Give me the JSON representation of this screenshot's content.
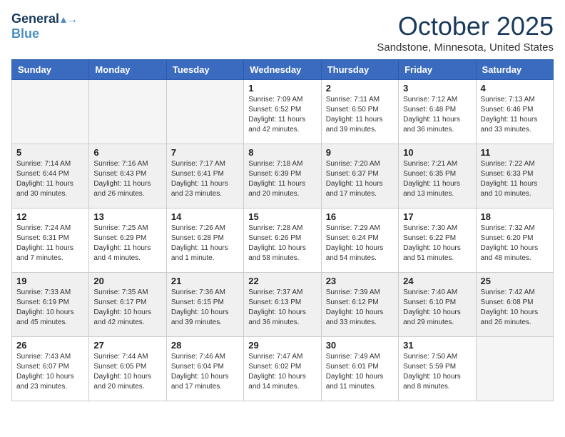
{
  "header": {
    "logo_line1": "General",
    "logo_line2": "Blue",
    "month": "October 2025",
    "location": "Sandstone, Minnesota, United States"
  },
  "days_of_week": [
    "Sunday",
    "Monday",
    "Tuesday",
    "Wednesday",
    "Thursday",
    "Friday",
    "Saturday"
  ],
  "weeks": [
    [
      {
        "day": "",
        "info": ""
      },
      {
        "day": "",
        "info": ""
      },
      {
        "day": "",
        "info": ""
      },
      {
        "day": "1",
        "info": "Sunrise: 7:09 AM\nSunset: 6:52 PM\nDaylight: 11 hours\nand 42 minutes."
      },
      {
        "day": "2",
        "info": "Sunrise: 7:11 AM\nSunset: 6:50 PM\nDaylight: 11 hours\nand 39 minutes."
      },
      {
        "day": "3",
        "info": "Sunrise: 7:12 AM\nSunset: 6:48 PM\nDaylight: 11 hours\nand 36 minutes."
      },
      {
        "day": "4",
        "info": "Sunrise: 7:13 AM\nSunset: 6:46 PM\nDaylight: 11 hours\nand 33 minutes."
      }
    ],
    [
      {
        "day": "5",
        "info": "Sunrise: 7:14 AM\nSunset: 6:44 PM\nDaylight: 11 hours\nand 30 minutes."
      },
      {
        "day": "6",
        "info": "Sunrise: 7:16 AM\nSunset: 6:43 PM\nDaylight: 11 hours\nand 26 minutes."
      },
      {
        "day": "7",
        "info": "Sunrise: 7:17 AM\nSunset: 6:41 PM\nDaylight: 11 hours\nand 23 minutes."
      },
      {
        "day": "8",
        "info": "Sunrise: 7:18 AM\nSunset: 6:39 PM\nDaylight: 11 hours\nand 20 minutes."
      },
      {
        "day": "9",
        "info": "Sunrise: 7:20 AM\nSunset: 6:37 PM\nDaylight: 11 hours\nand 17 minutes."
      },
      {
        "day": "10",
        "info": "Sunrise: 7:21 AM\nSunset: 6:35 PM\nDaylight: 11 hours\nand 13 minutes."
      },
      {
        "day": "11",
        "info": "Sunrise: 7:22 AM\nSunset: 6:33 PM\nDaylight: 11 hours\nand 10 minutes."
      }
    ],
    [
      {
        "day": "12",
        "info": "Sunrise: 7:24 AM\nSunset: 6:31 PM\nDaylight: 11 hours\nand 7 minutes."
      },
      {
        "day": "13",
        "info": "Sunrise: 7:25 AM\nSunset: 6:29 PM\nDaylight: 11 hours\nand 4 minutes."
      },
      {
        "day": "14",
        "info": "Sunrise: 7:26 AM\nSunset: 6:28 PM\nDaylight: 11 hours\nand 1 minute."
      },
      {
        "day": "15",
        "info": "Sunrise: 7:28 AM\nSunset: 6:26 PM\nDaylight: 10 hours\nand 58 minutes."
      },
      {
        "day": "16",
        "info": "Sunrise: 7:29 AM\nSunset: 6:24 PM\nDaylight: 10 hours\nand 54 minutes."
      },
      {
        "day": "17",
        "info": "Sunrise: 7:30 AM\nSunset: 6:22 PM\nDaylight: 10 hours\nand 51 minutes."
      },
      {
        "day": "18",
        "info": "Sunrise: 7:32 AM\nSunset: 6:20 PM\nDaylight: 10 hours\nand 48 minutes."
      }
    ],
    [
      {
        "day": "19",
        "info": "Sunrise: 7:33 AM\nSunset: 6:19 PM\nDaylight: 10 hours\nand 45 minutes."
      },
      {
        "day": "20",
        "info": "Sunrise: 7:35 AM\nSunset: 6:17 PM\nDaylight: 10 hours\nand 42 minutes."
      },
      {
        "day": "21",
        "info": "Sunrise: 7:36 AM\nSunset: 6:15 PM\nDaylight: 10 hours\nand 39 minutes."
      },
      {
        "day": "22",
        "info": "Sunrise: 7:37 AM\nSunset: 6:13 PM\nDaylight: 10 hours\nand 36 minutes."
      },
      {
        "day": "23",
        "info": "Sunrise: 7:39 AM\nSunset: 6:12 PM\nDaylight: 10 hours\nand 33 minutes."
      },
      {
        "day": "24",
        "info": "Sunrise: 7:40 AM\nSunset: 6:10 PM\nDaylight: 10 hours\nand 29 minutes."
      },
      {
        "day": "25",
        "info": "Sunrise: 7:42 AM\nSunset: 6:08 PM\nDaylight: 10 hours\nand 26 minutes."
      }
    ],
    [
      {
        "day": "26",
        "info": "Sunrise: 7:43 AM\nSunset: 6:07 PM\nDaylight: 10 hours\nand 23 minutes."
      },
      {
        "day": "27",
        "info": "Sunrise: 7:44 AM\nSunset: 6:05 PM\nDaylight: 10 hours\nand 20 minutes."
      },
      {
        "day": "28",
        "info": "Sunrise: 7:46 AM\nSunset: 6:04 PM\nDaylight: 10 hours\nand 17 minutes."
      },
      {
        "day": "29",
        "info": "Sunrise: 7:47 AM\nSunset: 6:02 PM\nDaylight: 10 hours\nand 14 minutes."
      },
      {
        "day": "30",
        "info": "Sunrise: 7:49 AM\nSunset: 6:01 PM\nDaylight: 10 hours\nand 11 minutes."
      },
      {
        "day": "31",
        "info": "Sunrise: 7:50 AM\nSunset: 5:59 PM\nDaylight: 10 hours\nand 8 minutes."
      },
      {
        "day": "",
        "info": ""
      }
    ]
  ]
}
